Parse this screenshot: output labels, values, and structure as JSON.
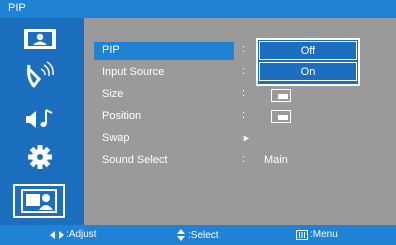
{
  "title": "PIP",
  "sidebar": {
    "tabs": [
      {
        "icon": "picture-icon"
      },
      {
        "icon": "input-signal-icon"
      },
      {
        "icon": "audio-icon"
      },
      {
        "icon": "settings-gear-icon"
      },
      {
        "icon": "pip-user-icon",
        "selected": true
      }
    ]
  },
  "menu": {
    "items": [
      {
        "label": "PIP",
        "value": ""
      },
      {
        "label": "Input Source",
        "value": ""
      },
      {
        "label": "Size",
        "value": ""
      },
      {
        "label": "Position",
        "value": ""
      },
      {
        "label": "Swap",
        "value": ""
      },
      {
        "label": "Sound Select",
        "value": "Main"
      }
    ],
    "colon": ":",
    "swap_arrow": "►"
  },
  "popup": {
    "options": [
      "Off",
      "On"
    ],
    "selected": "Off"
  },
  "footer": {
    "adjust": ":Adjust",
    "select": ":Select",
    "menu": ":Menu"
  },
  "colors": {
    "titlebar": "#1f82d4",
    "sidebar": "#1c6fbf",
    "panel": "#9a9a9a",
    "highlight": "#1f82d4"
  }
}
